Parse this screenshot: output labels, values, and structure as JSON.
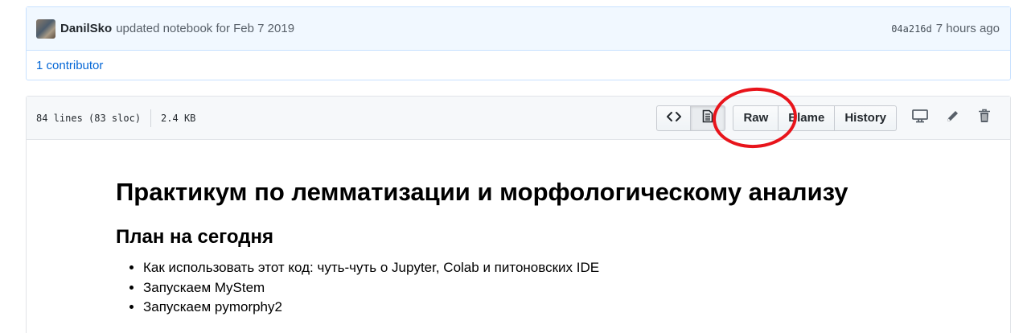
{
  "commit": {
    "author": "DanilSko",
    "message": "updated notebook for Feb 7 2019",
    "sha": "04a216d",
    "time": "7 hours ago"
  },
  "contributors": "1 contributor",
  "file": {
    "lines": "84 lines (83 sloc)",
    "size": "2.4 KB"
  },
  "toolbar": {
    "raw_label": "Raw",
    "blame_label": "Blame",
    "history_label": "History"
  },
  "icons": [
    "code-icon",
    "file-text-icon",
    "desktop-icon",
    "pencil-icon",
    "trash-icon"
  ],
  "document": {
    "title": "Практикум по лемматизации и морфологическому анализу",
    "subtitle": "План на сегодня",
    "items": [
      "Как использовать этот код: чуть-чуть о Jupyter, Colab и питоновских IDE",
      "Запускаем MyStem",
      "Запускаем pymorphy2"
    ]
  },
  "colors": {
    "link": "#0366d6",
    "commit_bg": "#f1f8ff",
    "annotation": "#e8141b"
  }
}
